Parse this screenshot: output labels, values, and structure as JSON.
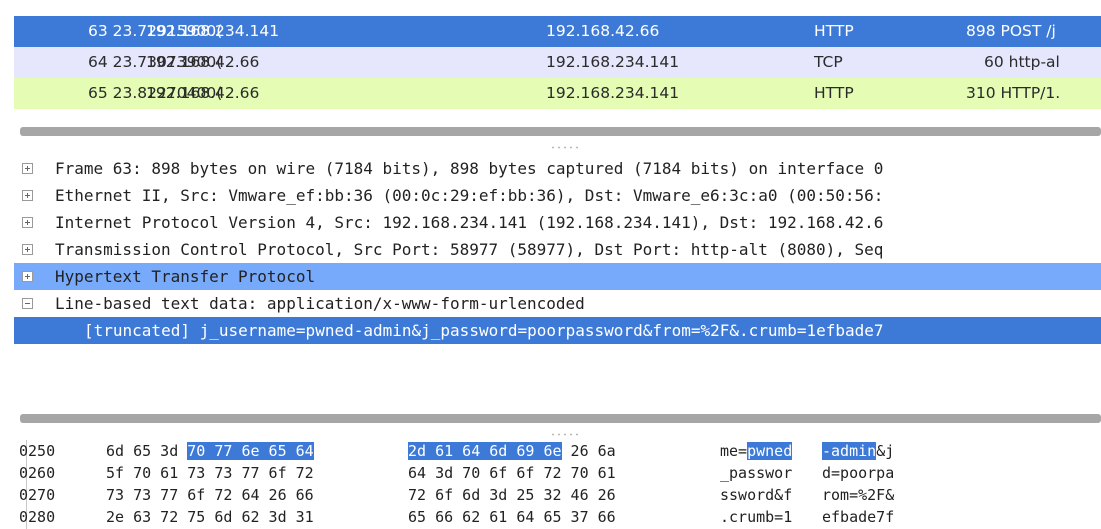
{
  "packet_list": {
    "rows": [
      {
        "no": "63",
        "time": "23.72915900(",
        "src": "192.168.234.141",
        "dst": "192.168.42.66",
        "protocol": "HTTP",
        "length": "898",
        "info": "POST /j",
        "bg": "#3d7ad8",
        "fg": "#ffffff"
      },
      {
        "no": "64",
        "time": "23.73073900(",
        "src": "192.168.42.66",
        "dst": "192.168.234.141",
        "protocol": "TCP",
        "length": "60",
        "info": "http-al",
        "bg": "#e6e6fc",
        "fg": "#2b2b2b"
      },
      {
        "no": "65",
        "time": "23.82270400(",
        "src": "192.168.42.66",
        "dst": "192.168.234.141",
        "protocol": "HTTP",
        "length": "310",
        "info": "HTTP/1.",
        "bg": "#e4fcb4",
        "fg": "#2b2b2b"
      }
    ]
  },
  "detail_tree": {
    "rows": [
      {
        "label": "Frame 63: 898 bytes on wire (7184 bits), 898 bytes captured (7184 bits) on interface 0",
        "expander": "plus",
        "state": "normal"
      },
      {
        "label": "Ethernet II, Src: Vmware_ef:bb:36 (00:0c:29:ef:bb:36), Dst: Vmware_e6:3c:a0 (00:50:56:",
        "expander": "plus",
        "state": "normal"
      },
      {
        "label": "Internet Protocol Version 4, Src: 192.168.234.141 (192.168.234.141), Dst: 192.168.42.6",
        "expander": "plus",
        "state": "normal"
      },
      {
        "label": "Transmission Control Protocol, Src Port: 58977 (58977), Dst Port: http-alt (8080), Seq",
        "expander": "plus",
        "state": "normal"
      },
      {
        "label": "Hypertext Transfer Protocol",
        "expander": "plus",
        "state": "selected-light"
      },
      {
        "label": "Line-based text data: application/x-www-form-urlencoded",
        "expander": "minus",
        "state": "normal"
      },
      {
        "label": "[truncated] j_username=pwned-admin&j_password=poorpassword&from=%2F&.crumb=1efbade7",
        "expander": "none",
        "state": "selected"
      }
    ]
  },
  "hex_dump": {
    "rows": [
      {
        "offset": "0250",
        "hex1_pre": "6d 65 3d ",
        "hex1_hl": "70 77 6e 65 64",
        "hex1_post": "",
        "hex2_pre": "",
        "hex2_hl": "2d 61 64 6d 69 6e",
        "hex2_post": " 26 6a",
        "ascii1_pre": "me=",
        "ascii1_hl": "pwned",
        "ascii1_post": "",
        "ascii2_pre": "",
        "ascii2_hl": "-admin",
        "ascii2_post": "&j"
      },
      {
        "offset": "0260",
        "hex1_pre": "5f 70 61 73 73 77 6f 72",
        "hex1_hl": "",
        "hex1_post": "",
        "hex2_pre": "64 3d 70 6f 6f 72 70 61",
        "hex2_hl": "",
        "hex2_post": "",
        "ascii1_pre": "_passwor",
        "ascii1_hl": "",
        "ascii1_post": "",
        "ascii2_pre": "d=poorpa",
        "ascii2_hl": "",
        "ascii2_post": ""
      },
      {
        "offset": "0270",
        "hex1_pre": "73 73 77 6f 72 64 26 66",
        "hex1_hl": "",
        "hex1_post": "",
        "hex2_pre": "72 6f 6d 3d 25 32 46 26",
        "hex2_hl": "",
        "hex2_post": "",
        "ascii1_pre": "ssword&f",
        "ascii1_hl": "",
        "ascii1_post": "",
        "ascii2_pre": "rom=%2F&",
        "ascii2_hl": "",
        "ascii2_post": ""
      },
      {
        "offset": "0280",
        "hex1_pre": "2e 63 72 75 6d 62 3d 31",
        "hex1_hl": "",
        "hex1_post": "",
        "hex2_pre": "65 66 62 61 64 65 37 66",
        "hex2_hl": "",
        "hex2_post": "",
        "ascii1_pre": ".crumb=1",
        "ascii1_hl": "",
        "ascii1_post": "",
        "ascii2_pre": "efbade7f",
        "ascii2_hl": "",
        "ascii2_post": ""
      }
    ]
  },
  "colors": {
    "selected": "#3d7ad8",
    "selected_light": "#77aafa",
    "tcp_row": "#e6e6fc",
    "http_row": "#e4fcb4",
    "splitter": "#a6a6a6"
  }
}
